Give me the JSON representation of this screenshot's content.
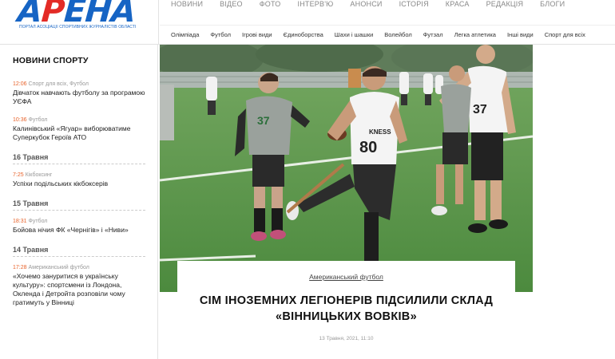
{
  "logo": {
    "name_part1": "А",
    "name_part2": "Р",
    "name_part3": "ЕНА",
    "tagline": "ПОРТАЛ АСОЦІАЦІЇ СПОРТИВНИХ ЖУРНАЛІСТІВ ОБЛАСТІ"
  },
  "top_nav": [
    "НОВИНИ",
    "ВІДЕО",
    "ФОТО",
    "ІНТЕРВ'Ю",
    "АНОНСИ",
    "ІСТОРІЯ",
    "КРАСА",
    "РЕДАКЦІЯ",
    "БЛОГИ"
  ],
  "category_nav": [
    "Олімпіада",
    "Футбол",
    "Ігрові види",
    "Єдиноборства",
    "Шахи і шашки",
    "Волейбол",
    "Футзал",
    "Легка атлетика",
    "Інші види",
    "Спорт для всіх"
  ],
  "sidebar": {
    "title": "НОВИНИ СПОРТУ",
    "news": [
      {
        "time": "12:06",
        "category": "Спорт для всіх, Футбол",
        "title": "Дівчаток навчають футболу за програмою УЄФА"
      },
      {
        "time": "10:36",
        "category": "Футбол",
        "title": "Калинівський «Ягуар» виборюватиме Суперкубок Героїв АТО"
      }
    ],
    "date1": "16 Травня",
    "news2": [
      {
        "time": "7:25",
        "category": "Кікбоксинг",
        "title": "Успіхи подільських кікбоксерів"
      }
    ],
    "date2": "15 Травня",
    "news3": [
      {
        "time": "18:31",
        "category": "Футбол",
        "title": "Бойова нічия ФК «Чернігів» і «Ниви»"
      }
    ],
    "date3": "14 Травня",
    "news4": [
      {
        "time": "17:28",
        "category": "Американський футбол",
        "title": "«Хочемо зануритися в українську культуру»: спортсмени із Лондона, Окленда і Детройта розповіли чому гратимуть у Вінниці"
      }
    ]
  },
  "article": {
    "category": "Американський футбол",
    "title": "СІМ ІНОЗЕМНИХ ЛЕГІОНЕРІВ ПІДСИЛИЛИ СКЛАД «ВІННИЦЬКИХ ВОВКІВ»",
    "date": "13 Травня, 2021, 11:10",
    "jersey_numbers": [
      "37",
      "80",
      "37"
    ],
    "jersey_brand": "KNESS"
  }
}
